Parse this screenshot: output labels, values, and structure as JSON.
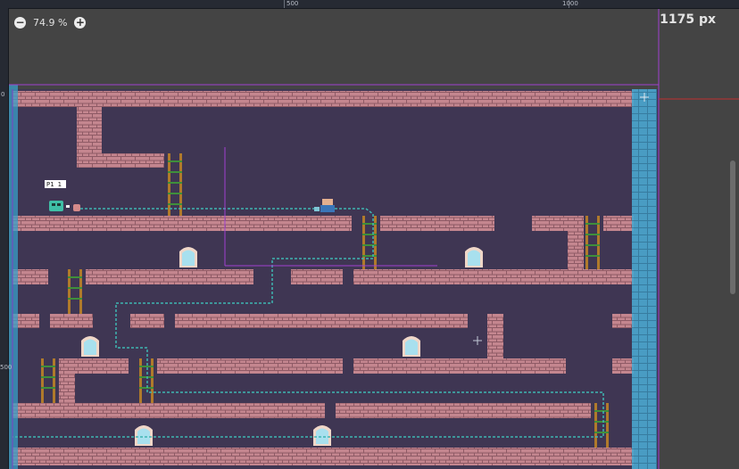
{
  "editor": {
    "zoom_out_symbol": "−",
    "zoom_in_symbol": "+",
    "zoom_level": "74.9 %",
    "ruler_readout": "1175 px",
    "ruler_top_marks": [
      "500",
      "1000"
    ],
    "ruler_left_marks": [
      "0",
      "500"
    ]
  },
  "scene": {
    "player_label": "P1 1",
    "colors": {
      "background": "#3f3653",
      "brick": "#c4868f",
      "brick_dark": "#8e5a65",
      "ladder": "#3f8f3a",
      "ladder_rail": "#b07a2b",
      "path": "#3fb6b2",
      "guide": "#a040d0",
      "border_column": "#3a9fc8",
      "window_glass": "#a8e0ee"
    }
  }
}
